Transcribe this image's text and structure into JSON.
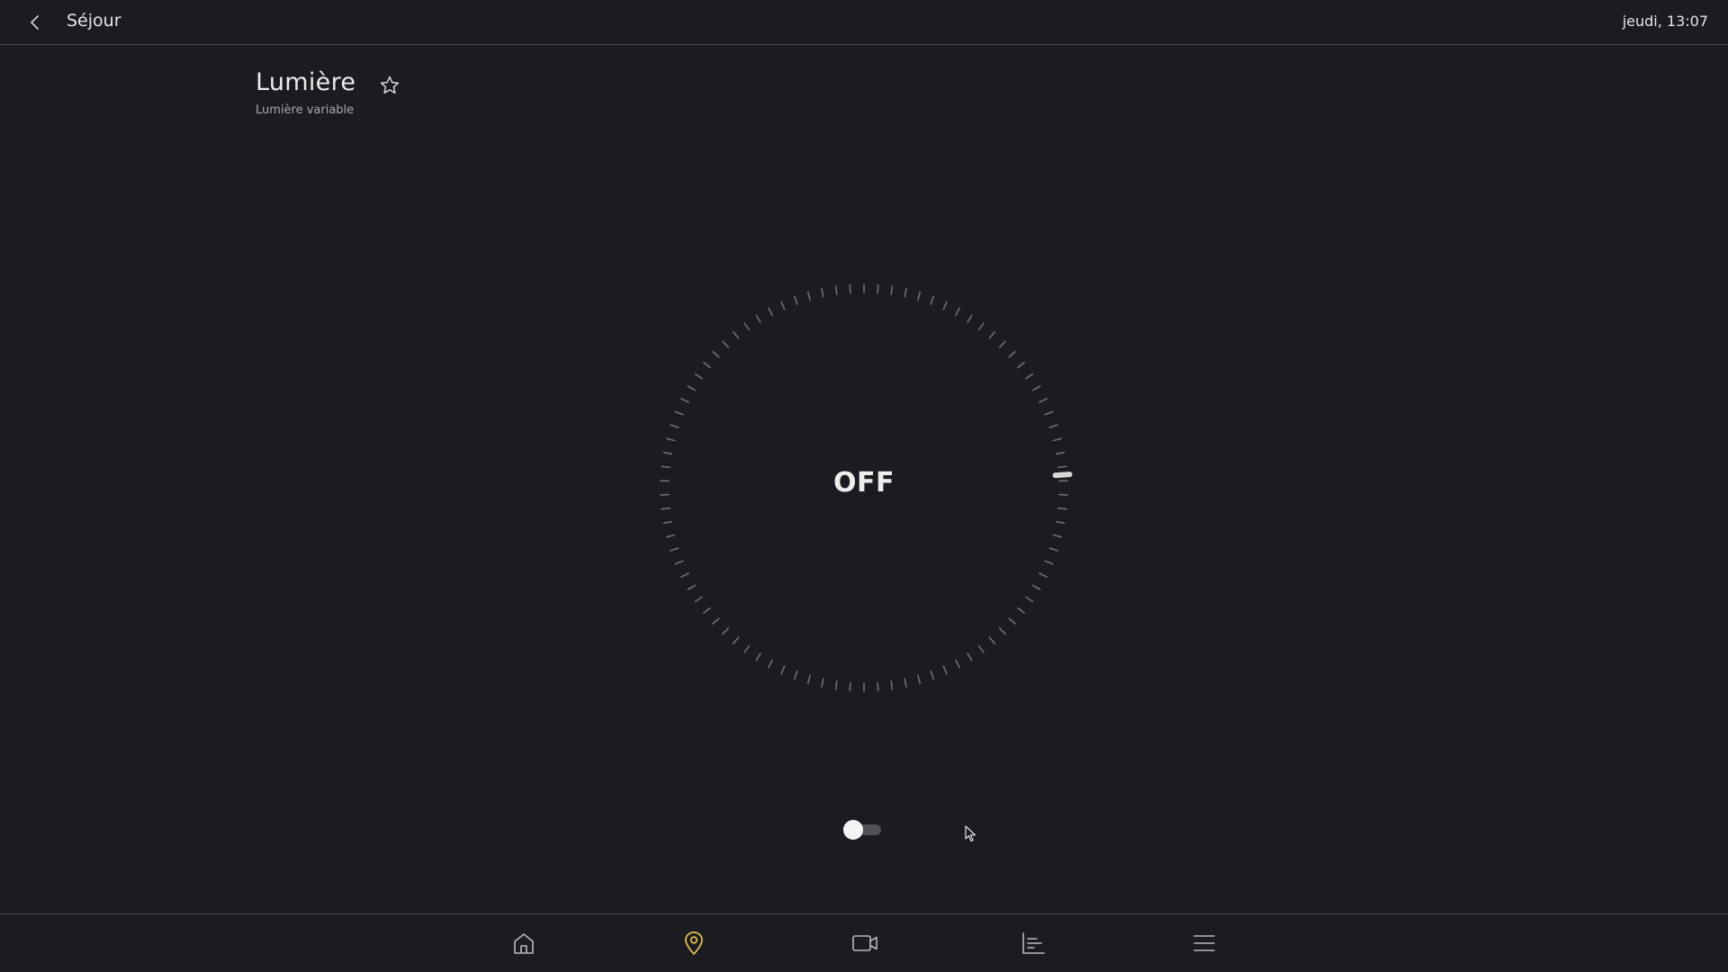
{
  "header": {
    "back_icon": "chevron-left-icon",
    "title": "Séjour",
    "clock": "jeudi, 13:07"
  },
  "device": {
    "title": "Lumière",
    "subtitle": "Lumière variable",
    "favorite_icon": "star-outline-icon"
  },
  "dimmer": {
    "state_label": "OFF",
    "level_percent": 0,
    "is_on": false
  },
  "nav": {
    "items": [
      {
        "name": "home-icon",
        "active": false
      },
      {
        "name": "location-pin-icon",
        "active": true
      },
      {
        "name": "video-camera-icon",
        "active": false
      },
      {
        "name": "chart-icon",
        "active": false
      },
      {
        "name": "menu-icon",
        "active": false
      }
    ],
    "active_color": "#e2bd4a",
    "inactive_color": "#b9b9bd"
  },
  "colors": {
    "background": "#1b1c21",
    "divider": "#4a4b50",
    "tick": "#6f7075",
    "handle": "#d6d6d6"
  }
}
